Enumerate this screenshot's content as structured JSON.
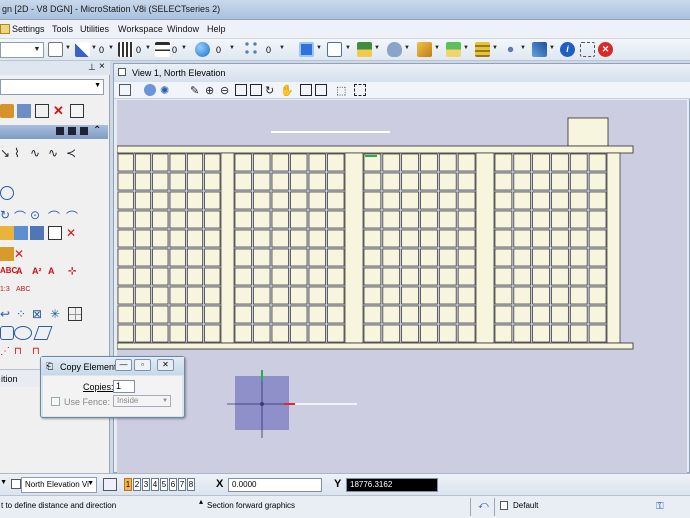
{
  "window": {
    "title": "gn [2D - V8 DGN] - MicroStation V8i (SELECTseries 2)"
  },
  "menu": [
    "Settings",
    "Tools",
    "Utilities",
    "Workspace",
    "Window",
    "Help"
  ],
  "toolbar": {
    "values": [
      "0",
      "0",
      "0",
      "0",
      "0"
    ]
  },
  "view": {
    "title": "View 1, North Elevation"
  },
  "left_panel": {
    "bottom_label": "ition"
  },
  "copy_dialog": {
    "title": "Copy Element",
    "copies_label": "Copies:",
    "copies_value": "1",
    "use_fence_label": "Use Fence:",
    "fence_mode": "Inside"
  },
  "status": {
    "view_name": "North Elevation Vi",
    "view_buttons": [
      "1",
      "2",
      "3",
      "4",
      "5",
      "6",
      "7",
      "8"
    ],
    "active_view": "1",
    "x_label": "X",
    "x_value": "0.0000",
    "y_label": "Y",
    "y_value": "18776.3162",
    "prompt": "t to define distance and direction",
    "message": "Section forward graphics",
    "level": "Default"
  },
  "colors": {
    "canvas_bg": "#cdcde1",
    "building_fill": "#f7f5dd",
    "building_stroke": "#2b2b2b",
    "handle_fill": "#8f8fc9",
    "accent_red": "#e2262b",
    "accent_green": "#22b14c"
  }
}
